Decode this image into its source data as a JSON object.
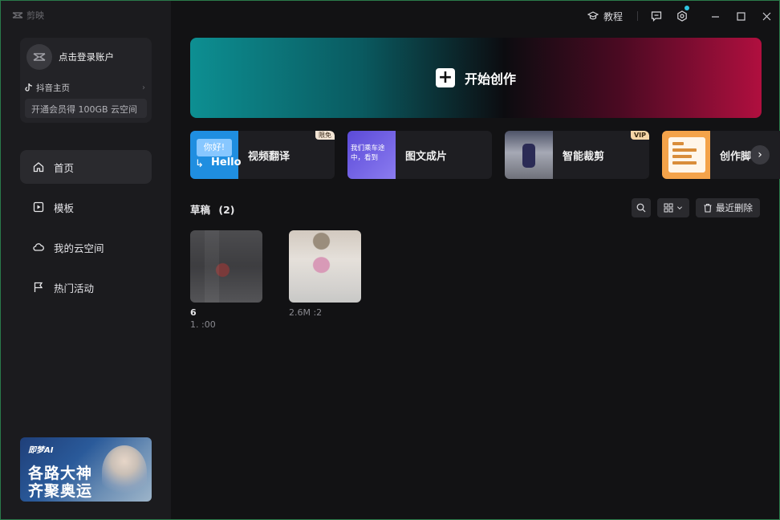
{
  "app": {
    "logo_text": "剪映"
  },
  "account": {
    "login_label": "点击登录账户",
    "douyin_label": "抖音主页",
    "vip_strip": "开通会员得 100GB 云空间"
  },
  "nav": [
    {
      "label": "首页",
      "icon": "home-icon",
      "active": true
    },
    {
      "label": "模板",
      "icon": "template-icon",
      "active": false
    },
    {
      "label": "我的云空间",
      "icon": "cloud-icon",
      "active": false
    },
    {
      "label": "热门活动",
      "icon": "flag-icon",
      "active": false
    }
  ],
  "promo": {
    "brand": "即梦AI",
    "line1": "各路大神",
    "line2": "齐聚奥运"
  },
  "titlebar": {
    "tutorial_label": "教程"
  },
  "hero": {
    "label": "开始创作"
  },
  "tools": [
    {
      "name": "视频翻译",
      "badge": "限免",
      "thumb_bubble": "你好!",
      "thumb_hello": "Hello"
    },
    {
      "name": "图文成片",
      "thumb_text": "我们乘车途中，看到"
    },
    {
      "name": "智能裁剪",
      "badge": "VIP"
    },
    {
      "name": "创作脚本"
    }
  ],
  "drafts_section": {
    "title": "草稿",
    "count": "(2)",
    "recent_delete": "最近删除"
  },
  "drafts": [
    {
      "title": "6",
      "meta": "1.  :00"
    },
    {
      "title": "",
      "meta": "2.6M  :2"
    }
  ],
  "colors": {
    "accent_dot": "#2fc4e0",
    "hero_start": "#0d8f92",
    "hero_end": "#b00f3f",
    "badge_vip": "#f5d6a8"
  }
}
